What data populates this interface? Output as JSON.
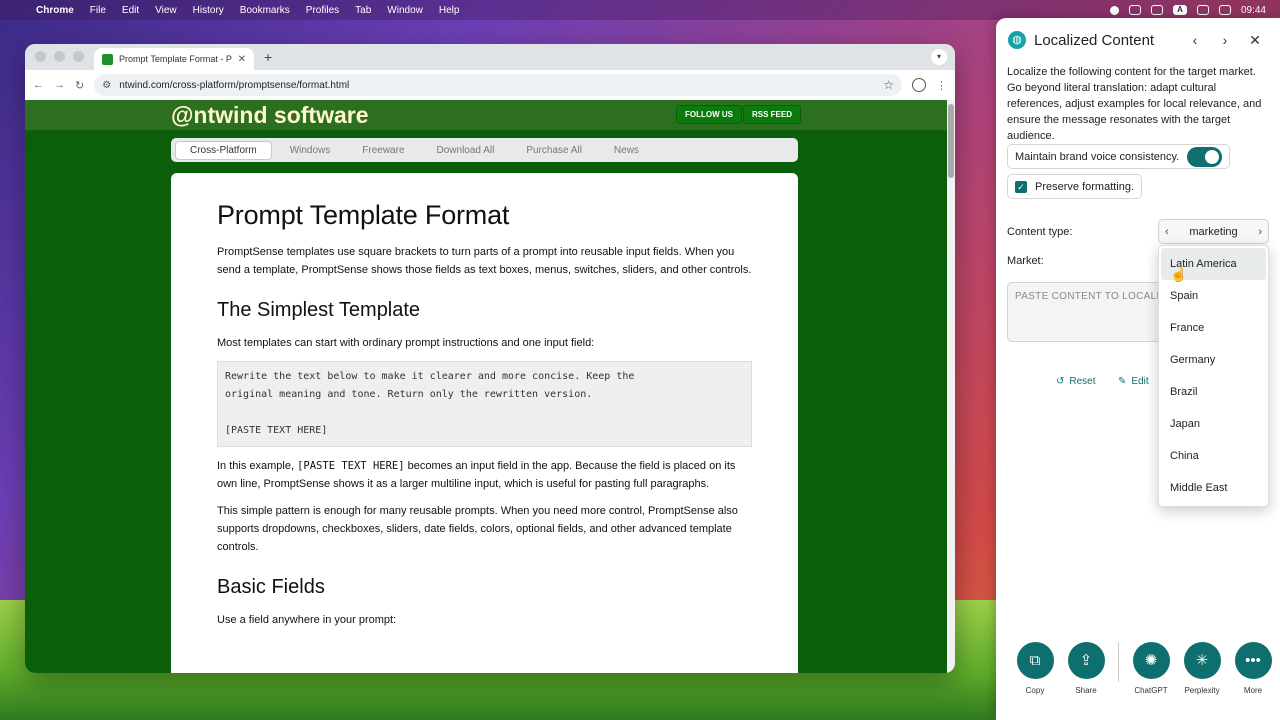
{
  "menubar": {
    "app": "Chrome",
    "items": [
      "File",
      "Edit",
      "View",
      "History",
      "Bookmarks",
      "Profiles",
      "Tab",
      "Window",
      "Help"
    ],
    "clock": "09:44",
    "input_indicator": "A"
  },
  "browser": {
    "tab_title": "Prompt Template Format - Pr",
    "url": "ntwind.com/cross-platform/promptsense/format.html"
  },
  "site": {
    "logo": "@ntwind software",
    "follow_label": "FOLLOW US",
    "rss_label": "RSS FEED",
    "nav": [
      "Cross-Platform",
      "Windows",
      "Freeware",
      "Download All",
      "Purchase All",
      "News"
    ],
    "article": {
      "h1": "Prompt Template Format",
      "p1": "PromptSense templates use square brackets to turn parts of a prompt into reusable input fields. When you send a template, PromptSense shows those fields as text boxes, menus, switches, sliders, and other controls.",
      "h2a": "The Simplest Template",
      "p2": "Most templates can start with ordinary prompt instructions and one input field:",
      "code": "Rewrite the text below to make it clearer and more concise. Keep the\noriginal meaning and tone. Return only the rewritten version.\n\n[PASTE TEXT HERE]",
      "p3_pre": "In this example, ",
      "p3_code": "[PASTE TEXT HERE]",
      "p3_post": " becomes an input field in the app. Because the field is placed on its own line, PromptSense shows it as a larger multiline input, which is useful for pasting full paragraphs.",
      "p4": "This simple pattern is enough for many reusable prompts. When you need more control, PromptSense also supports dropdowns, checkboxes, sliders, date fields, colors, optional fields, and other advanced template controls.",
      "h2b": "Basic Fields",
      "p5": "Use a field anywhere in your prompt:"
    }
  },
  "panel": {
    "title": "Localized Content",
    "instructions": "Localize the following content for the target market. Go beyond literal translation: adapt cultural references, adjust examples for local relevance, and ensure the message resonates with the target audience.",
    "brand_voice_label": "Maintain brand voice consistency.",
    "preserve_label": "Preserve formatting.",
    "content_type_label": "Content type:",
    "content_type_value": "marketing",
    "market_label": "Market:",
    "content_placeholder": "PASTE CONTENT TO LOCALIZE",
    "reset_label": "Reset",
    "edit_label": "Edit",
    "market_options": [
      "Latin America",
      "Spain",
      "France",
      "Germany",
      "Brazil",
      "Japan",
      "China",
      "Middle East"
    ],
    "bottom": [
      {
        "label": "Copy",
        "icon": "copy-icon"
      },
      {
        "label": "Share",
        "icon": "share-icon"
      },
      {
        "label": "ChatGPT",
        "icon": "chatgpt-icon"
      },
      {
        "label": "Perplexity",
        "icon": "perplexity-icon"
      },
      {
        "label": "More",
        "icon": "more-icon"
      }
    ]
  }
}
